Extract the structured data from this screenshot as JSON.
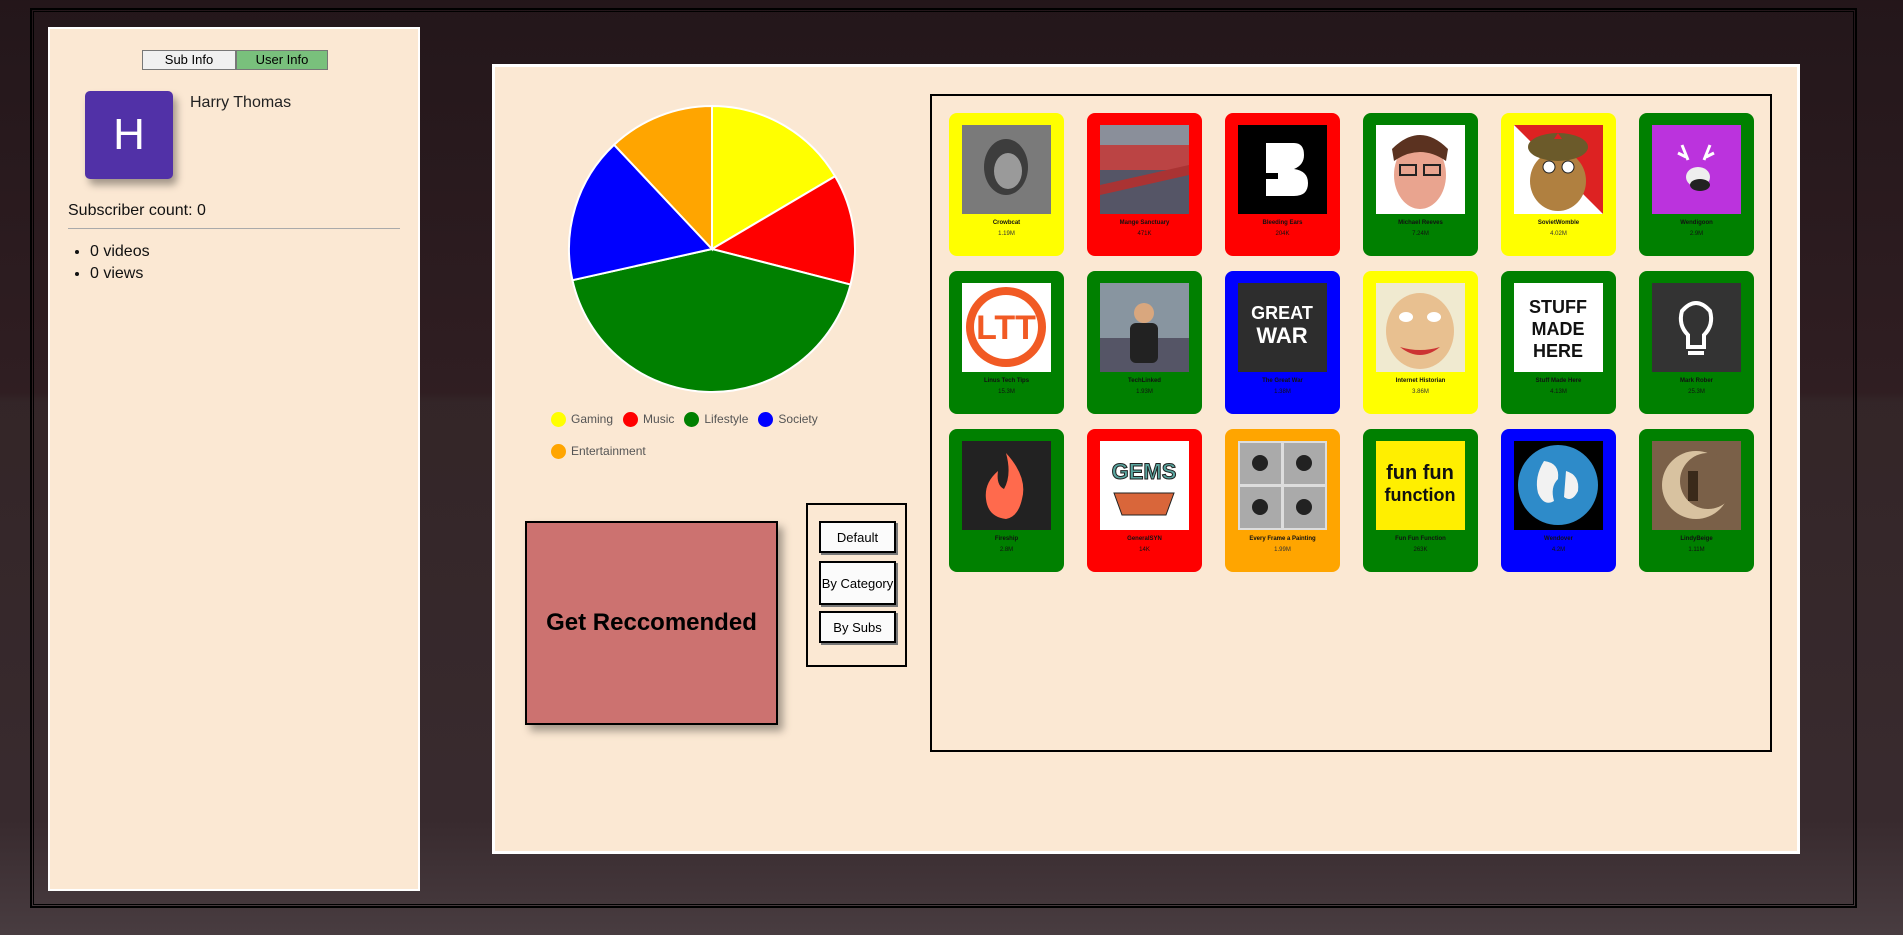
{
  "user_panel": {
    "tabs": [
      "Sub Info",
      "User Info"
    ],
    "avatar_letter": "H",
    "name": "Harry Thomas",
    "subscriber_count": "Subscriber count: 0",
    "stats": [
      "0 videos",
      "0 views"
    ]
  },
  "chart_data": {
    "type": "pie",
    "slices": [
      {
        "label": "Gaming",
        "value": 16.5,
        "color": "#ffff00"
      },
      {
        "label": "Music",
        "value": 12.5,
        "color": "#ff0000"
      },
      {
        "label": "Lifestyle",
        "value": 42.5,
        "color": "#008000"
      },
      {
        "label": "Society",
        "value": 16.5,
        "color": "#0000ff"
      },
      {
        "label": "Entertainment",
        "value": 12.0,
        "color": "#ffa500"
      }
    ]
  },
  "actions": {
    "recommend": "Get Reccomended",
    "sort": [
      "Default",
      "By Category",
      "By Subs"
    ]
  },
  "channels": [
    {
      "name": "Crowbcat",
      "subs": "1.19M",
      "category": "yellow",
      "thumb": "portrait-gray"
    },
    {
      "name": "Mange Sanctuary",
      "subs": "471K",
      "category": "red",
      "thumb": "rooftops"
    },
    {
      "name": "Bleeding Ears",
      "subs": "204K",
      "category": "red",
      "thumb": "b-logo"
    },
    {
      "name": "Michael Reeves",
      "subs": "7.24M",
      "category": "green",
      "thumb": "cartoon-face"
    },
    {
      "name": "SovietWomble",
      "subs": "4.02M",
      "category": "yellow",
      "thumb": "cartoon-hat"
    },
    {
      "name": "Wendigoon",
      "subs": "2.9M",
      "category": "green",
      "thumb": "deer-skull"
    },
    {
      "name": "Linus Tech Tips",
      "subs": "15.3M",
      "category": "green",
      "thumb": "ltt-logo"
    },
    {
      "name": "TechLinked",
      "subs": "1.93M",
      "category": "green",
      "thumb": "person-photo"
    },
    {
      "name": "The Great War",
      "subs": "1.38M",
      "category": "blue",
      "thumb": "great-war-logo"
    },
    {
      "name": "Internet Historian",
      "subs": "3.86M",
      "category": "yellow",
      "thumb": "cartoon-man"
    },
    {
      "name": "Stuff Made Here",
      "subs": "4.13M",
      "category": "green",
      "thumb": "stuff-made-here-logo"
    },
    {
      "name": "Mark Rober",
      "subs": "25.3M",
      "category": "green",
      "thumb": "bulb-logo"
    },
    {
      "name": "Fireship",
      "subs": "2.8M",
      "category": "green",
      "thumb": "fire-logo"
    },
    {
      "name": "GeneralSYN",
      "subs": "14K",
      "category": "red",
      "thumb": "gems-logo"
    },
    {
      "name": "Every Frame a Painting",
      "subs": "1.99M",
      "category": "orange",
      "thumb": "horse-frames"
    },
    {
      "name": "Fun Fun Function",
      "subs": "263K",
      "category": "green",
      "thumb": "fun-fun-logo"
    },
    {
      "name": "Wendover",
      "subs": "4.2M",
      "category": "blue",
      "thumb": "globe-logo"
    },
    {
      "name": "LindyBeige",
      "subs": "1.11M",
      "category": "green",
      "thumb": "moon-photo"
    }
  ]
}
